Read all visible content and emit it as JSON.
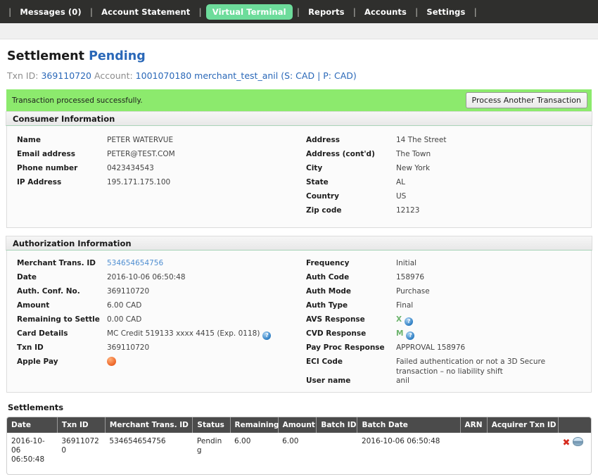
{
  "nav": {
    "separator": "|",
    "items": [
      {
        "label": "Messages (0)",
        "active": false
      },
      {
        "label": "Account Statement",
        "active": false
      },
      {
        "label": "Virtual Terminal",
        "active": true
      },
      {
        "label": "Reports",
        "active": false
      },
      {
        "label": "Accounts",
        "active": false
      },
      {
        "label": "Settings",
        "active": false
      }
    ],
    "active_color": "#6ddc9b",
    "background": "#2f2f2d"
  },
  "page": {
    "title": "Settlement",
    "status": "Pending",
    "status_color": "#2a68b8",
    "subtitle": {
      "txn_label": "Txn ID:",
      "txn_value": "369110720",
      "account_label": "Account:",
      "account_value": "1001070180 merchant_test_anil (S: CAD | P: CAD)"
    }
  },
  "alert": {
    "message": "Transaction processed successfully.",
    "button_label": "Process Another Transaction",
    "background": "#8cea6d"
  },
  "consumer": {
    "heading": "Consumer Information",
    "left": [
      {
        "key": "Name",
        "value": "PETER WATERVUE"
      },
      {
        "key": "Email address",
        "value": "PETER@TEST.COM"
      },
      {
        "key": "Phone number",
        "value": "0423434543"
      },
      {
        "key": "IP Address",
        "value": "195.171.175.100"
      }
    ],
    "right": [
      {
        "key": "Address",
        "value": "14 The Street"
      },
      {
        "key": "Address (cont'd)",
        "value": "The Town"
      },
      {
        "key": "City",
        "value": "New York"
      },
      {
        "key": "State",
        "value": "AL"
      },
      {
        "key": "Country",
        "value": "US"
      },
      {
        "key": "Zip code",
        "value": "12123"
      }
    ]
  },
  "authorization": {
    "heading": "Authorization Information",
    "left": {
      "merchant_trans_id_key": "Merchant Trans. ID",
      "merchant_trans_id_value": "534654654756",
      "date_key": "Date",
      "date_value": "2016-10-06 06:50:48",
      "auth_conf_key": "Auth. Conf. No.",
      "auth_conf_value": "369110720",
      "amount_key": "Amount",
      "amount_value": "6.00 CAD",
      "remaining_key": "Remaining to Settle",
      "remaining_value": "0.00 CAD",
      "card_details_key": "Card Details",
      "card_details_value": "MC Credit 519133 xxxx 4415 (Exp. 0118)",
      "txn_id_key": "Txn ID",
      "txn_id_value": "369110720",
      "apple_pay_key": "Apple Pay",
      "apple_pay_indicator": "apple-pay-status-dot"
    },
    "right": {
      "frequency_key": "Frequency",
      "frequency_value": "Initial",
      "auth_code_key": "Auth Code",
      "auth_code_value": "158976",
      "auth_mode_key": "Auth Mode",
      "auth_mode_value": "Purchase",
      "auth_type_key": "Auth Type",
      "auth_type_value": "Final",
      "avs_key": "AVS Response",
      "avs_value": "X",
      "cvd_key": "CVD Response",
      "cvd_value": "M",
      "pay_proc_key": "Pay Proc Response",
      "pay_proc_value": "APPROVAL 158976",
      "eci_key": "ECI Code",
      "eci_value": "Failed authentication or not a 3D Secure transaction – no liability shift",
      "user_name_key": "User name",
      "user_name_value": "anil"
    },
    "help_icon_glyph": "?"
  },
  "settlements": {
    "heading": "Settlements",
    "columns": [
      "Date",
      "Txn ID",
      "Merchant Trans. ID",
      "Status",
      "Remaining",
      "Amount",
      "Batch ID",
      "Batch Date",
      "ARN",
      "Acquirer Txn ID",
      ""
    ],
    "rows": [
      {
        "date": "2016-10-06 06:50:48",
        "txn_id": "369110720",
        "merchant_trans_id": "534654654756",
        "status": "Pending",
        "remaining": "6.00",
        "amount": "6.00",
        "batch_id": "",
        "batch_date": "2016-10-06 06:50:48",
        "arn": "",
        "acquirer_txn_id": "",
        "actions": {
          "void_icon": "✖",
          "settle_icon": "settle-disk-icon"
        }
      }
    ]
  }
}
